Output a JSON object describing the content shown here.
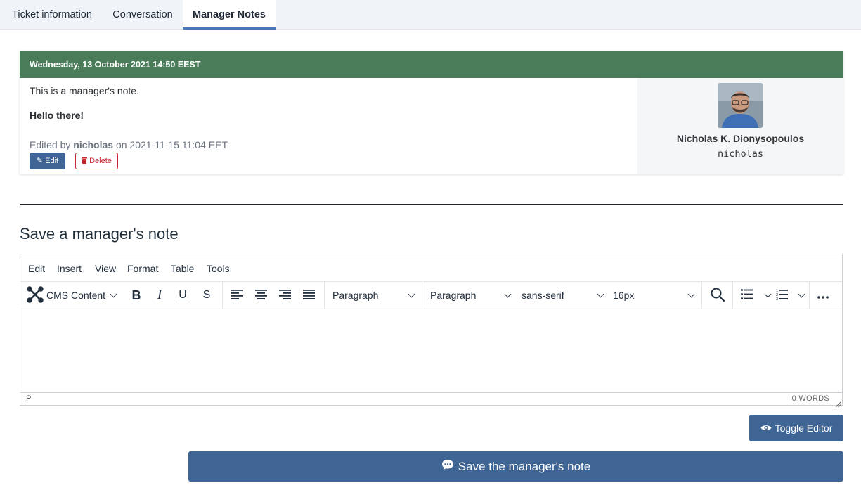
{
  "tabs": {
    "ticket_info": "Ticket information",
    "conversation": "Conversation",
    "manager_notes": "Manager Notes"
  },
  "note": {
    "date_header": "Wednesday, 13 October 2021 14:50 EEST",
    "text": "This is a manager's note.",
    "bold_text": "Hello there!",
    "edited_prefix": "Edited by",
    "edited_user": "nicholas",
    "edited_suffix": "on 2021-11-15 11:04 EET",
    "edit_label": "Edit",
    "delete_label": "Delete",
    "author_name": "Nicholas K. Dionysopoulos",
    "author_username": "nicholas",
    "header_color": "#4a7c59"
  },
  "section_title": "Save a manager's note",
  "editor": {
    "menu": [
      "Edit",
      "Insert",
      "View",
      "Format",
      "Table",
      "Tools"
    ],
    "cms_content": "CMS Content",
    "block_format": "Paragraph",
    "block_format_2": "Paragraph",
    "font_family": "sans-serif",
    "font_size": "16px",
    "status_path": "P",
    "word_count": "0 WORDS"
  },
  "toggle_editor_label": "Toggle Editor",
  "save_label": "Save the manager's note",
  "accent_color": "#3f6595"
}
